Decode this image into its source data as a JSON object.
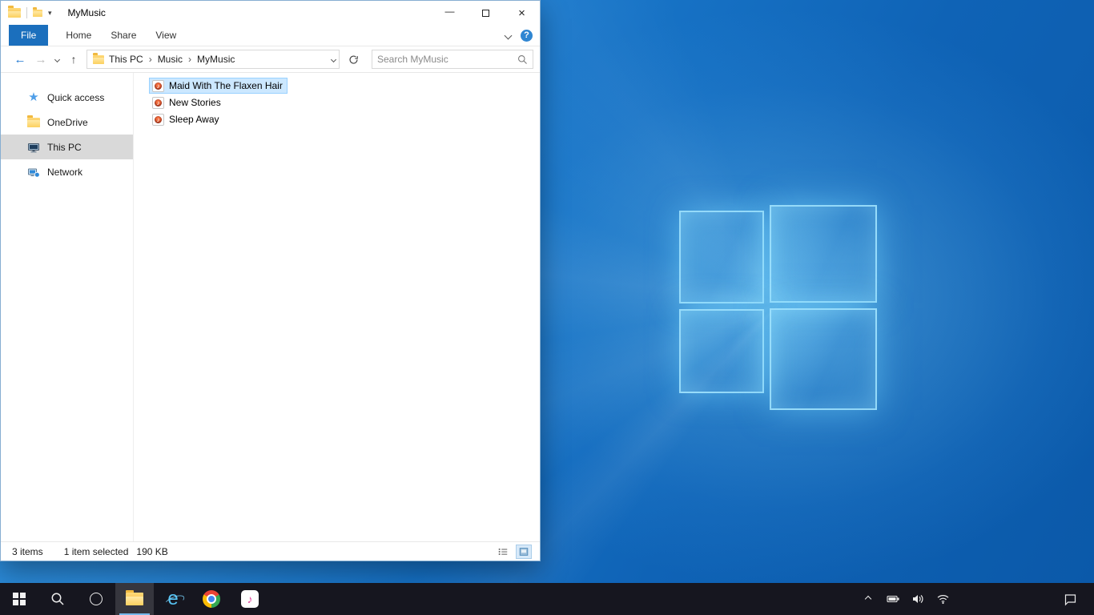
{
  "colors": {
    "accent": "#0078d7",
    "file_tab": "#1b6fbd",
    "selection_bg": "#cce8ff",
    "selection_border": "#99d1ff",
    "sidebar_selected": "#d9d9d9",
    "taskbar_bg": "#16161f",
    "taskbar_underline": "#76b9ed",
    "folder_a": "#ffd978",
    "folder_b": "#f1b93f",
    "desktop_top": "#2f94e0",
    "desktop_bottom": "#0b59a9"
  },
  "icons": {
    "back": "←",
    "forward": "→",
    "up": "↑",
    "crumb_separator": "›",
    "quick_access_star": "★",
    "help": "?",
    "close": "×",
    "minimize": "—",
    "qat_chevron": "▾",
    "music_note": "♪"
  },
  "window": {
    "title": "MyMusic",
    "tabs": [
      "File",
      "Home",
      "Share",
      "View"
    ],
    "nav": {
      "crumbs": [
        "This PC",
        "Music",
        "MyMusic"
      ],
      "search_placeholder": "Search MyMusic"
    },
    "sidebar": [
      {
        "label": "Quick access"
      },
      {
        "label": "OneDrive"
      },
      {
        "label": "This PC",
        "selected": true
      },
      {
        "label": "Network"
      }
    ],
    "files": [
      {
        "name": "Maid With The Flaxen Hair",
        "selected": true
      },
      {
        "name": "New Stories"
      },
      {
        "name": "Sleep Away"
      }
    ],
    "status": {
      "count": "3 items",
      "selected": "1 item selected",
      "size": "190 KB"
    }
  },
  "taskbar": {
    "apps": [
      {
        "name": "start"
      },
      {
        "name": "search"
      },
      {
        "name": "cortana"
      },
      {
        "name": "file-explorer",
        "active": true
      },
      {
        "name": "internet-explorer"
      },
      {
        "name": "chrome"
      },
      {
        "name": "itunes"
      }
    ],
    "tray": [
      {
        "name": "hidden-icons"
      },
      {
        "name": "battery"
      },
      {
        "name": "volume"
      },
      {
        "name": "network"
      },
      {
        "name": "action-center"
      }
    ]
  }
}
